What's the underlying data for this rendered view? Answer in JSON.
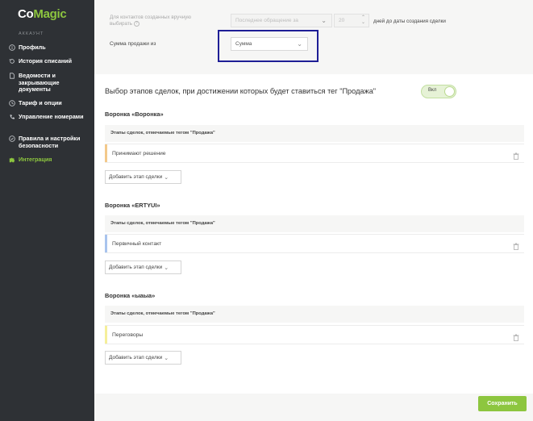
{
  "sidebar": {
    "logo_main": "Co",
    "logo_accent": "Magic",
    "section_label": "АККАУНТ",
    "items": [
      {
        "label": "Профиль",
        "icon": "info-icon"
      },
      {
        "label": "История списаний",
        "icon": "history-icon"
      },
      {
        "label": "Ведомости и закрывающие документы",
        "icon": "document-icon"
      },
      {
        "label": "Тариф и опции",
        "icon": "clock-icon"
      },
      {
        "label": "Управление номерами",
        "icon": "phone-icon"
      },
      {
        "label": "Правила и настройки безопасности",
        "icon": "shield-icon"
      },
      {
        "label": "Интеграция",
        "icon": "puzzle-icon"
      }
    ],
    "active_index": 6
  },
  "settings": {
    "contacts_label": "Для контактов созданных вручную выбирать",
    "last_contact_select": "Последнее обращение за",
    "days_value": "20",
    "days_suffix": "дней до даты создания сделки",
    "sale_amount_label": "Сумма продажи из",
    "sale_amount_select": "Сумма"
  },
  "stages_section": {
    "title": "Выбор этапов сделок, при достижении которых будет ставиться тег \"Продажа\"",
    "toggle_label": "Вкл",
    "toggle_on": true
  },
  "funnels": [
    {
      "title": "Воронка «Воронка»",
      "header": "Этапы сделок, отмечаемые тегом \"Продажа\"",
      "stage": "Принимают решение",
      "stage_color": "#f3c98b",
      "add_label": "Добавить этап сделки"
    },
    {
      "title": "Воронка «ERTYUI»",
      "header": "Этапы сделок, отмечаемые тегом \"Продажа\"",
      "stage": "Первичный контакт",
      "stage_color": "#a9c4ee",
      "add_label": "Добавить этап сделки"
    },
    {
      "title": "Воронка «ыаыа»",
      "header": "Этапы сделок, отмечаемые тегом \"Продажа\"",
      "stage": "Переговоры",
      "stage_color": "#f5ef9a",
      "add_label": "Добавить этап сделки"
    }
  ],
  "footer": {
    "save_label": "Сохранить"
  },
  "colors": {
    "accent": "#8dc63f",
    "sidebar_bg": "#2e3135",
    "highlight_border": "#1e1e96"
  }
}
